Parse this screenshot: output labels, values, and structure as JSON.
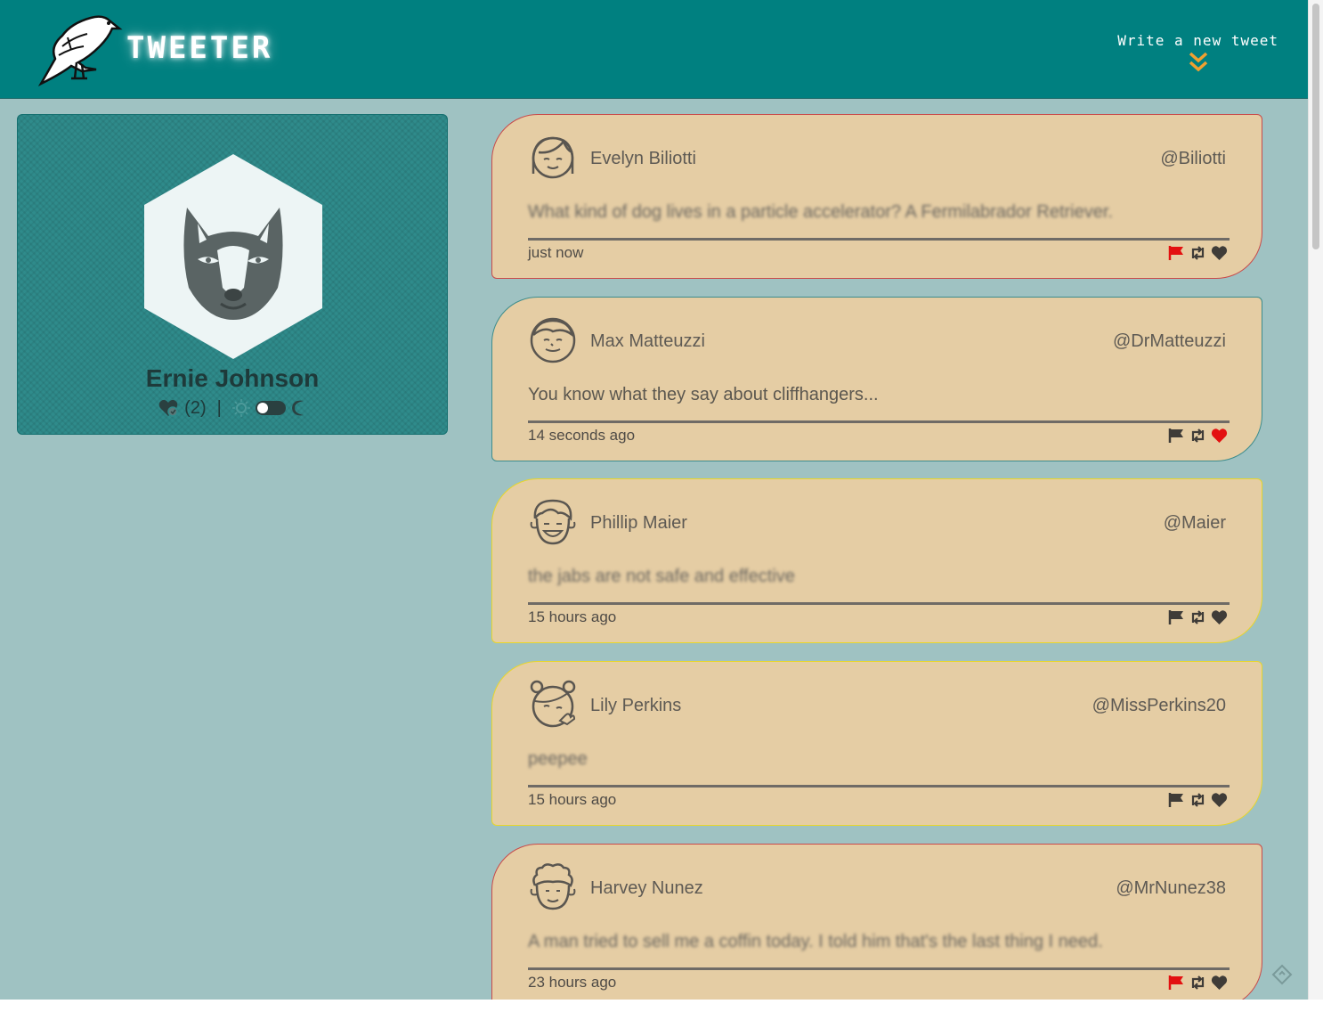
{
  "nav": {
    "brand": "TWEETER",
    "compose_label": "Write a new tweet",
    "colors": {
      "bar": "#008080",
      "arrow": "#f0a030"
    }
  },
  "profile": {
    "name": "Ernie Johnson",
    "likes_count": "(2)",
    "separator": "|",
    "avatar_icon": "husky-icon",
    "theme_toggle": {
      "left_icon": "sun-icon",
      "right_icon": "moon-icon",
      "state": "light"
    }
  },
  "tweets": [
    {
      "author": "Evelyn Biliotti",
      "handle": "@Biliotti",
      "content": "What kind of dog lives in a particle accelerator? A Fermilabrador Retriever.",
      "time": "just now",
      "flagged": true,
      "liked": false,
      "blurred": true,
      "border": "#c84a4a"
    },
    {
      "author": "Max Matteuzzi",
      "handle": "@DrMatteuzzi",
      "content": "You know what they say about cliffhangers...",
      "time": "14 seconds ago",
      "flagged": false,
      "liked": true,
      "blurred": false,
      "border": "#3d8c8c"
    },
    {
      "author": "Phillip Maier",
      "handle": "@Maier",
      "content": "the jabs are not safe and effective",
      "time": "15 hours ago",
      "flagged": false,
      "liked": false,
      "blurred": true,
      "border": "#e8d62a"
    },
    {
      "author": "Lily Perkins",
      "handle": "@MissPerkins20",
      "content": "peepee",
      "time": "15 hours ago",
      "flagged": false,
      "liked": false,
      "blurred": true,
      "border": "#e8d62a"
    },
    {
      "author": "Harvey Nunez",
      "handle": "@MrNunez38",
      "content": "A man tried to sell me a coffin today. I told him that's the last thing I need.",
      "time": "23 hours ago",
      "flagged": true,
      "liked": false,
      "blurred": true,
      "border": "#c84a4a"
    }
  ]
}
